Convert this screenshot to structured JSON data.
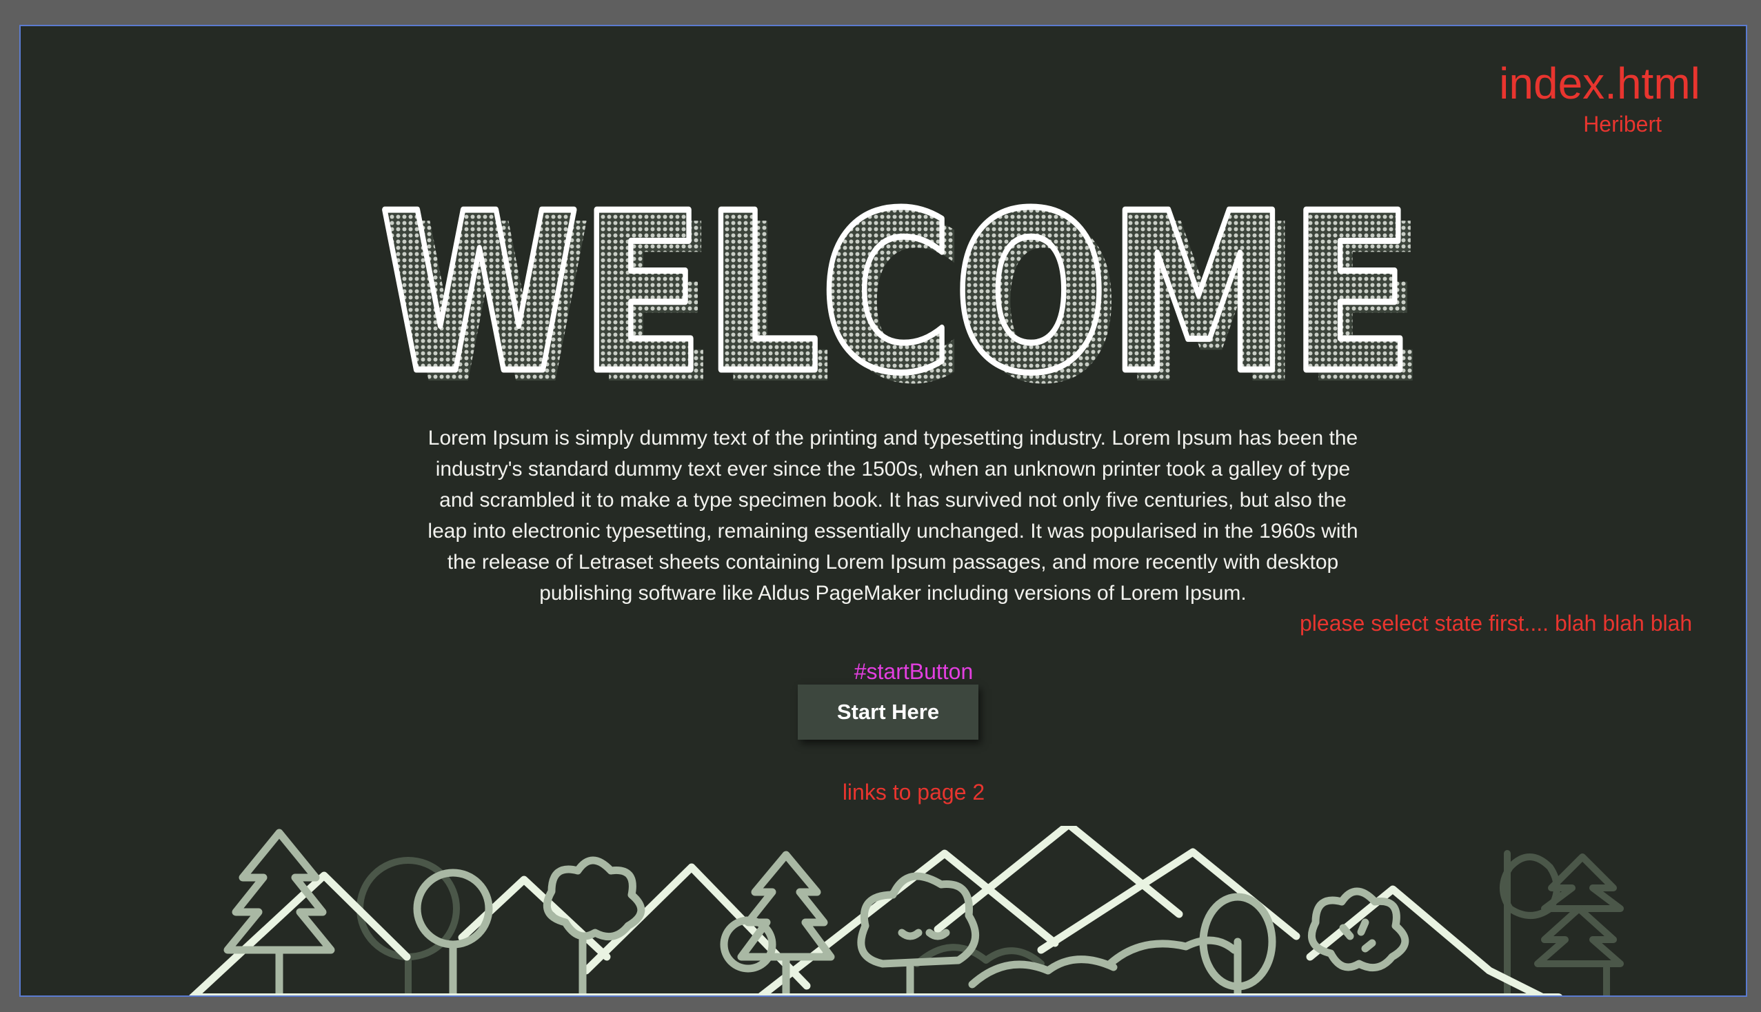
{
  "header": {
    "file_name": "index.html",
    "author": "Heribert"
  },
  "hero": {
    "title": "WELCOME"
  },
  "intro": {
    "paragraph": "Lorem Ipsum is simply dummy text of the printing and typesetting industry. Lorem Ipsum has been the industry's standard dummy text ever since the 1500s, when an unknown printer took a galley of type and scrambled it to make a type specimen book. It has survived not only five centuries, but also the leap into electronic typesetting, remaining essentially unchanged. It was popularised in the 1960s with the release of Letraset sheets containing Lorem Ipsum passages, and more recently with desktop publishing software like Aldus PageMaker including versions of Lorem Ipsum."
  },
  "annotations": {
    "state_note": "please select state first.... blah blah blah",
    "button_id": "#startButton",
    "link_note": "links to page 2"
  },
  "start_button": {
    "label": "Start Here"
  },
  "colors": {
    "background": "#252a24",
    "canvas": "#5f5f5f",
    "annotation_red": "#e8352f",
    "annotation_magenta": "#e33fe0",
    "button_bg": "#3d473e",
    "tree_light": "#e9f3e2",
    "tree_mid": "#a9b8a4",
    "tree_dark": "#4b5749"
  },
  "icons": {
    "landscape": "trees-and-mountains-illustration"
  }
}
